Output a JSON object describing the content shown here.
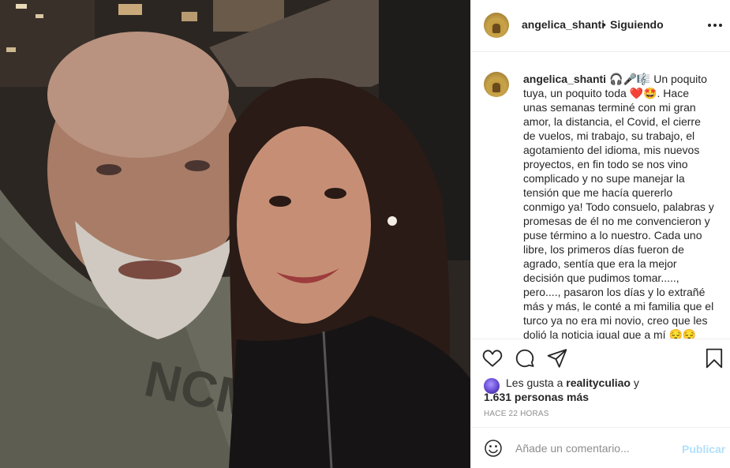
{
  "post": {
    "username": "angelica_shanti",
    "follow_status": "Siguiendo",
    "separator": "•",
    "caption_emojis": "🎧🎤🎼",
    "caption_text": "Un poquito tuya, un poquito toda ❤️🤩. Hace unas semanas terminé con mi gran amor, la distancia, el Covid, el cierre de vuelos, mi trabajo, su trabajo, el agotamiento del idioma, mis nuevos proyectos, en fin todo se nos vino complicado y no supe manejar la tensión que me hacía quererlo conmigo ya! Todo consuelo, palabras y promesas de él no me convencieron y puse término a lo nuestro. Cada uno libre, los primeros días fueron de agrado, sentía que era la mejor decisión que pudimos tomar....., pero...., pasaron los días y lo extrañé más y más, le conté a mi familia que el turco ya no era mi novio, creo que les dolió la noticia igual que a mí 😔😔",
    "liked_by_prefix": "Les gusta a",
    "liked_by_user": "realityculiao",
    "liked_by_suffix": "y",
    "likes_others": "1.631 personas más",
    "timestamp": "HACE 22 HORAS"
  },
  "comment": {
    "placeholder": "Añade un comentario...",
    "post_label": "Publicar"
  },
  "colors": {
    "text": "#262626",
    "secondary": "#8e8e8e",
    "border": "#efefef",
    "publish_disabled": "#b2dffc"
  },
  "icons": [
    "more-options-icon",
    "heart-icon",
    "comment-icon",
    "share-icon",
    "bookmark-icon",
    "smiley-icon"
  ]
}
